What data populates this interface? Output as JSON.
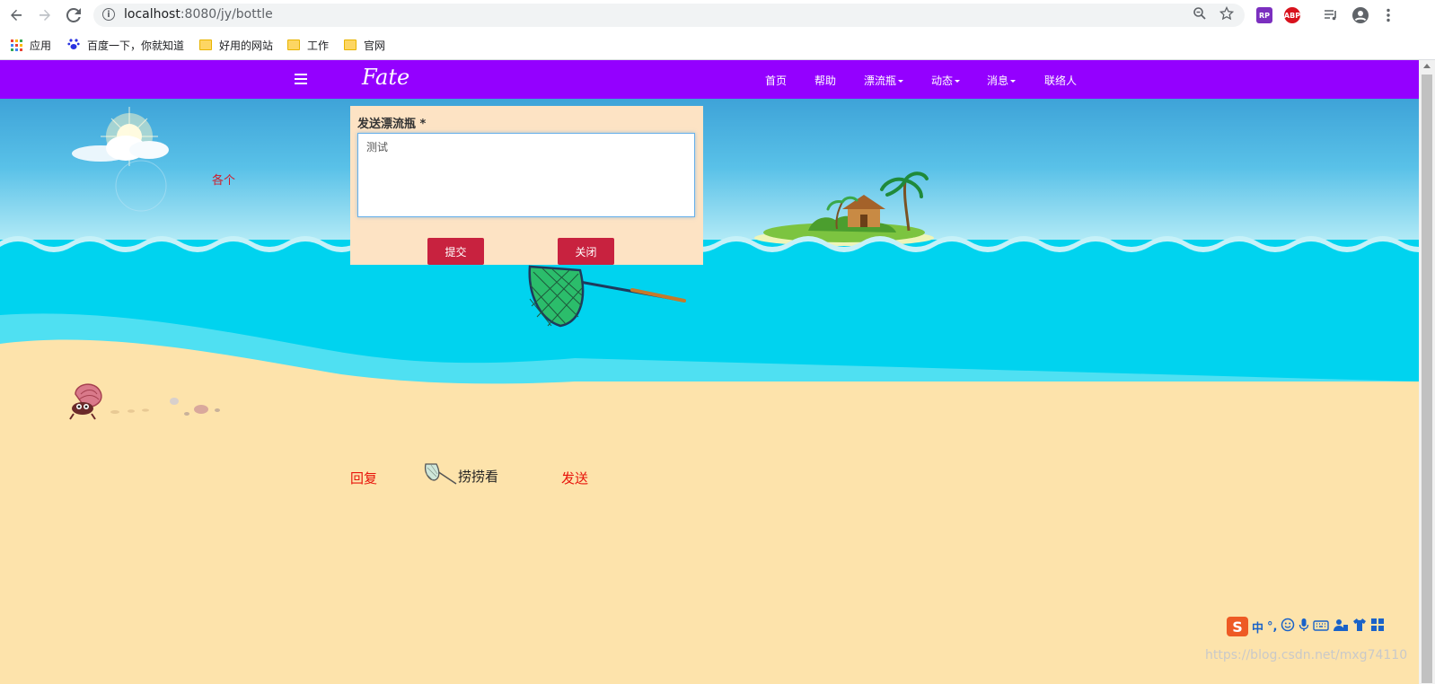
{
  "browser": {
    "url_host": "localhost",
    "url_path": ":8080/jy/bottle",
    "extensions": [
      {
        "name": "rp-extension-icon",
        "label": "RP",
        "color": "#7b2fbf"
      },
      {
        "name": "adblock-plus-icon",
        "label": "ABP",
        "color": "#d8121d"
      }
    ],
    "bookmarks": [
      {
        "label": "应用",
        "icon": "apps-grid-icon"
      },
      {
        "label": "百度一下，你就知道",
        "icon": "baidu-paw-icon"
      },
      {
        "label": "好用的网站",
        "icon": "folder-icon"
      },
      {
        "label": "工作",
        "icon": "folder-icon"
      },
      {
        "label": "官网",
        "icon": "folder-icon"
      }
    ]
  },
  "navbar": {
    "brand": "Fate",
    "color": "#9400ff",
    "items": [
      {
        "label": "首页",
        "dropdown": false
      },
      {
        "label": "帮助",
        "dropdown": false
      },
      {
        "label": "漂流瓶",
        "dropdown": true
      },
      {
        "label": "动态",
        "dropdown": true
      },
      {
        "label": "消息",
        "dropdown": true
      },
      {
        "label": "联络人",
        "dropdown": false
      }
    ]
  },
  "page": {
    "red_label": "各个",
    "actions": {
      "reply": "回复",
      "fish": "捞捞看",
      "send": "发送"
    }
  },
  "modal": {
    "label": "发送漂流瓶 *",
    "textarea_value": "测试",
    "submit": "提交",
    "close": "关闭",
    "button_color": "#c8223f"
  },
  "ime": {
    "logo": "S",
    "mode": "中",
    "punct": "°,"
  },
  "watermark": "https://blog.csdn.net/mxg74110"
}
